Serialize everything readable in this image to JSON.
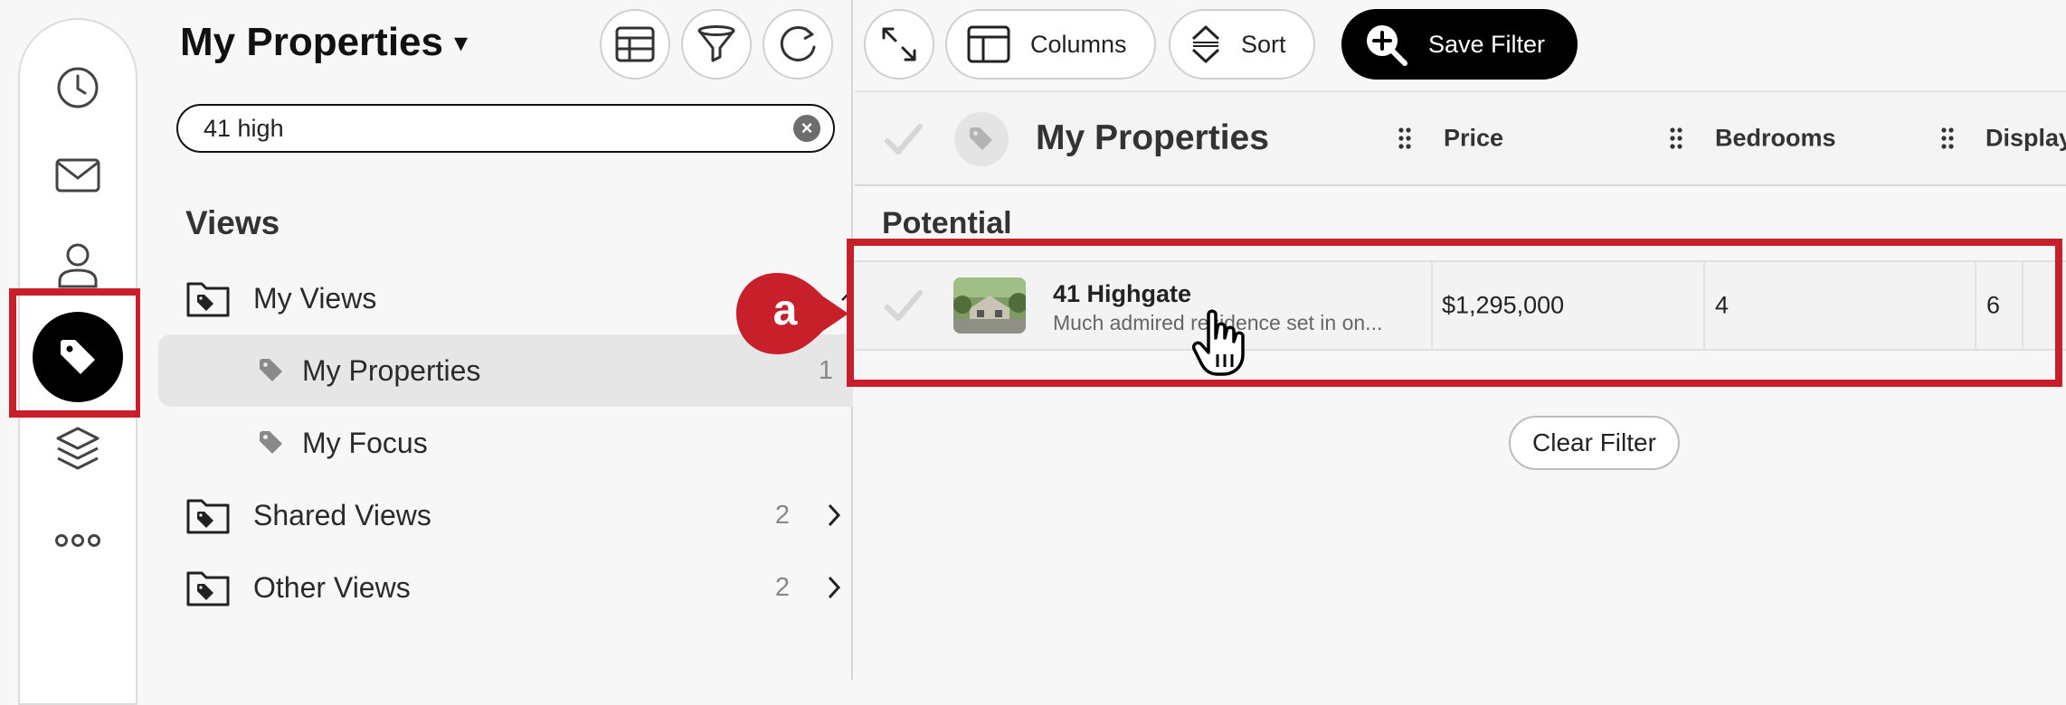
{
  "rail": {
    "icons": [
      "clock-icon",
      "mail-icon",
      "person-icon",
      "tag-icon",
      "layers-icon",
      "more-icon"
    ],
    "active": "tag-icon",
    "highlight_color": "#c8202b"
  },
  "views_panel": {
    "title": "My Properties",
    "title_caret": "▾",
    "search": {
      "value": "41 high",
      "placeholder": ""
    },
    "heading": "Views",
    "items": [
      {
        "label": "My Views",
        "type": "folder",
        "count": "",
        "expanded": true
      },
      {
        "label": "My Properties",
        "type": "view",
        "count": "1",
        "selected": true
      },
      {
        "label": "My Focus",
        "type": "view",
        "count": ""
      },
      {
        "label": "Shared Views",
        "type": "folder",
        "count": "2"
      },
      {
        "label": "Other Views",
        "type": "folder",
        "count": "2"
      }
    ]
  },
  "toolbar": {
    "columns_label": "Columns",
    "sort_label": "Sort",
    "save_filter_label": "Save Filter"
  },
  "table": {
    "title": "My Properties",
    "columns": [
      "Price",
      "Bedrooms",
      "Display"
    ],
    "group": "Potential",
    "rows": [
      {
        "name": "41 Highgate",
        "description": "Much admired residence set in on...",
        "price": "$1,295,000",
        "bedrooms": "4",
        "display": "6"
      }
    ],
    "clear_filter_label": "Clear Filter"
  },
  "callout": {
    "letter": "a",
    "color": "#c8202b"
  }
}
